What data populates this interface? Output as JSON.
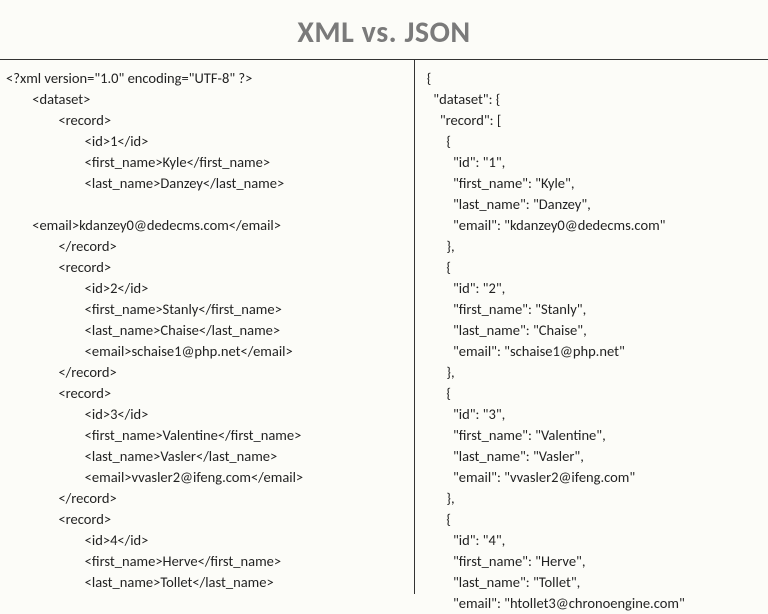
{
  "title": "XML vs. JSON",
  "xml": {
    "line1": "<?xml version=\"1.0\" encoding=\"UTF-8\" ?>",
    "line2": "        <dataset>",
    "line3": "                <record>",
    "line4": "                        <id>1</id>",
    "line5": "                        <first_name>Kyle</first_name>",
    "line6": "                        <last_name>Danzey</last_name>",
    "line7": "",
    "line8": "        <email>kdanzey0@dedecms.com</email>",
    "line9": "                </record>",
    "line10": "                <record>",
    "line11": "                        <id>2</id>",
    "line12": "                        <first_name>Stanly</first_name>",
    "line13": "                        <last_name>Chaise</last_name>",
    "line14": "                        <email>schaise1@php.net</email>",
    "line15": "                </record>",
    "line16": "                <record>",
    "line17": "                        <id>3</id>",
    "line18": "                        <first_name>Valentine</first_name>",
    "line19": "                        <last_name>Vasler</last_name>",
    "line20": "                        <email>vvasler2@ifeng.com</email>",
    "line21": "                </record>",
    "line22": "                <record>",
    "line23": "                        <id>4</id>",
    "line24": "                        <first_name>Herve</first_name>",
    "line25": "                        <last_name>Tollet</last_name>"
  },
  "json": {
    "line1": "{",
    "line2": "  \"dataset\": {",
    "line3": "    \"record\": [",
    "line4": "      {",
    "line5": "        \"id\": \"1\",",
    "line6": "        \"first_name\": \"Kyle\",",
    "line7": "        \"last_name\": \"Danzey\",",
    "line8": "        \"email\": \"kdanzey0@dedecms.com\"",
    "line9": "      },",
    "line10": "      {",
    "line11": "        \"id\": \"2\",",
    "line12": "        \"first_name\": \"Stanly\",",
    "line13": "        \"last_name\": \"Chaise\",",
    "line14": "        \"email\": \"schaise1@php.net\"",
    "line15": "      },",
    "line16": "      {",
    "line17": "        \"id\": \"3\",",
    "line18": "        \"first_name\": \"Valentine\",",
    "line19": "        \"last_name\": \"Vasler\",",
    "line20": "        \"email\": \"vvasler2@ifeng.com\"",
    "line21": "      },",
    "line22": "      {",
    "line23": "        \"id\": \"4\",",
    "line24": "        \"first_name\": \"Herve\",",
    "line25": "        \"last_name\": \"Tollet\",",
    "line26": "        \"email\": \"htollet3@chronoengine.com\""
  }
}
